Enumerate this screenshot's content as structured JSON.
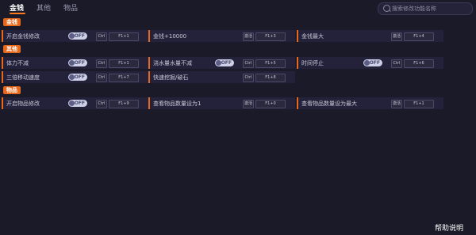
{
  "tabs": [
    {
      "label": "金钱",
      "active": true
    },
    {
      "label": "其他",
      "active": false
    },
    {
      "label": "物品",
      "active": false
    }
  ],
  "search": {
    "placeholder": "搜索修改功能名称"
  },
  "sections": {
    "money": {
      "title": "金钱"
    },
    "other": {
      "title": "其他"
    },
    "items": {
      "title": "物品"
    }
  },
  "rows": {
    "money_unlimited": {
      "label": "开启金钱修改",
      "toggle": "OFF",
      "mod": "Ctrl",
      "hotkey": "F1+1"
    },
    "money_add": {
      "label": "金钱+10000",
      "mod": "激活",
      "hotkey": "F1+3"
    },
    "money_max": {
      "label": "金钱最大",
      "mod": "激活",
      "hotkey": "F1+4"
    },
    "stamina": {
      "label": "体力不减",
      "toggle": "OFF",
      "mod": "Ctrl",
      "hotkey": "F1+1"
    },
    "water": {
      "label": "浇水量水量不减",
      "toggle": "OFF",
      "mod": "Ctrl",
      "hotkey": "F1+5"
    },
    "time_stop": {
      "label": "时间停止",
      "toggle": "OFF",
      "mod": "Ctrl",
      "hotkey": "F1+6"
    },
    "triple_speed": {
      "label": "三倍移动速度",
      "toggle": "OFF",
      "mod": "Ctrl",
      "hotkey": "F1+7"
    },
    "fast_mine": {
      "label": "快速挖掘/破石",
      "mod": "Ctrl",
      "hotkey": "F1+8"
    },
    "item_mod": {
      "label": "开启物品修改",
      "toggle": "OFF",
      "mod": "Ctrl",
      "hotkey": "F1+9"
    },
    "item_set_1": {
      "label": "查看物品数量设为1",
      "mod": "激活",
      "hotkey": "F1+0"
    },
    "item_set_max": {
      "label": "查看物品数量设为最大",
      "mod": "激活",
      "hotkey": "F1+1"
    }
  },
  "help": {
    "label": "帮助说明"
  },
  "colors": {
    "accent": "#e8671b",
    "background": "#1b1a28",
    "row": "#23223a"
  }
}
